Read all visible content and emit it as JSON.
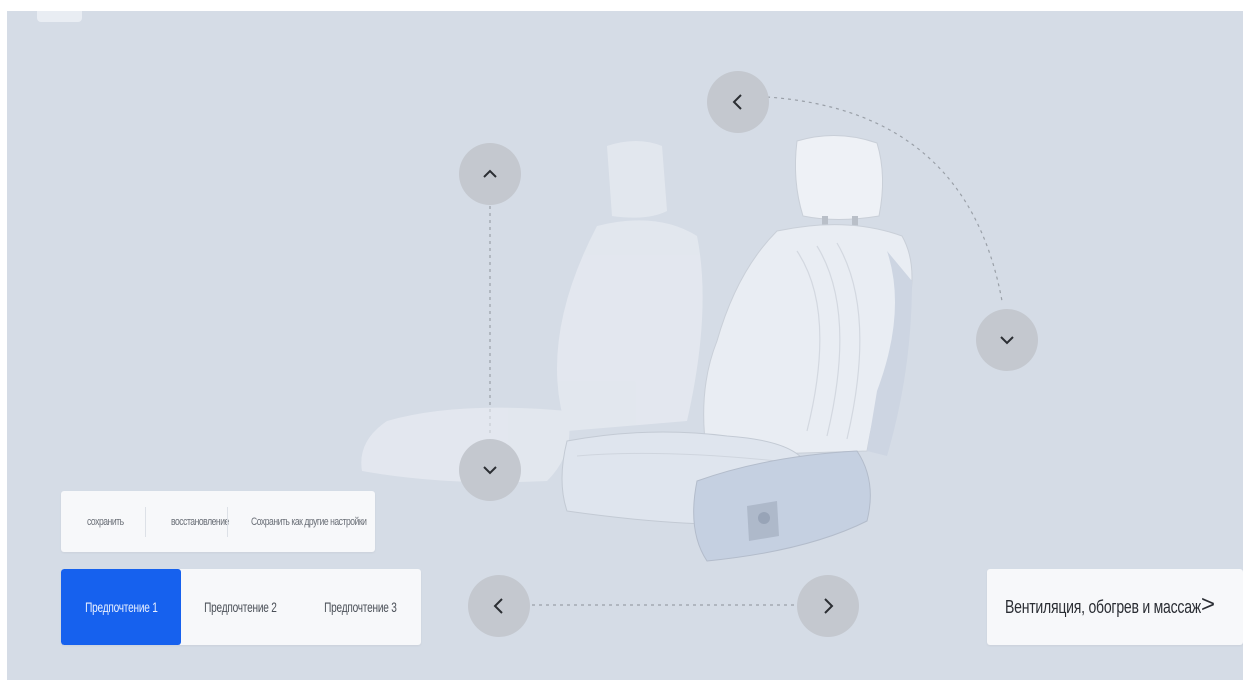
{
  "actions": {
    "save": "сохранить",
    "reset": "восстановление",
    "save_as_other": "Сохранить как другие настройки"
  },
  "preferences": [
    {
      "label": "Предпочтение 1",
      "active": true
    },
    {
      "label": "Предпочтение 2",
      "active": false
    },
    {
      "label": "Предпочтение 3",
      "active": false
    }
  ],
  "vent_panel": {
    "label": "Вентиляция, обогрев и массаж",
    "arrow": ">"
  },
  "icons": {
    "backrest_tilt_back": "chevron-left-icon",
    "backrest_tilt_forward": "chevron-down-icon",
    "seat_height_up": "chevron-up-icon",
    "seat_height_down": "chevron-down-icon",
    "seat_move_back": "chevron-left-icon",
    "seat_move_forward": "chevron-right-icon"
  },
  "colors": {
    "background": "#d5dce6",
    "accent": "#1661ee",
    "panel": "#f7f8fa",
    "control": "#c4c8cf"
  }
}
